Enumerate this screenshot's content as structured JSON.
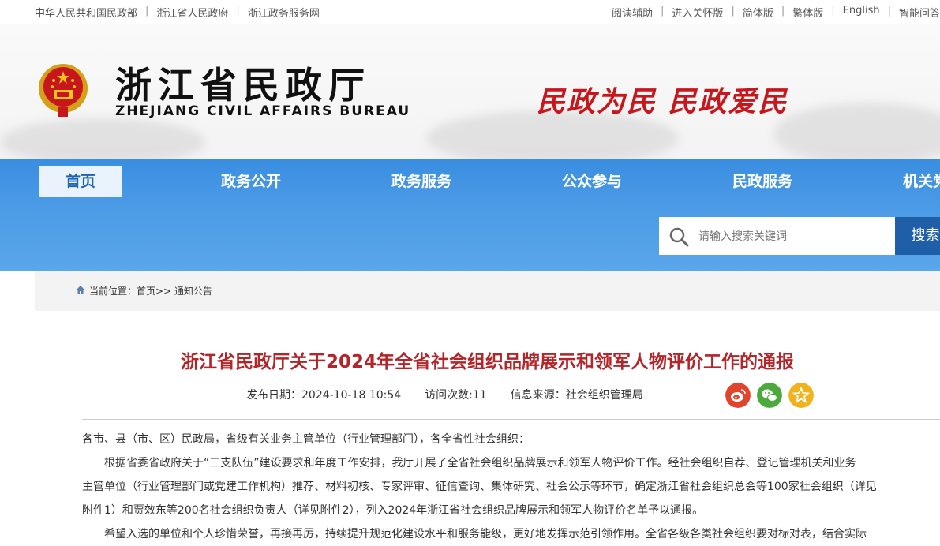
{
  "topbar": {
    "left_links": [
      "中华人民共和国民政部",
      "浙江省人民政府",
      "浙江政务服务网"
    ],
    "right_links": [
      "阅读辅助",
      "进入关怀版",
      "简体版",
      "繁体版",
      "English",
      "智能问答"
    ]
  },
  "header": {
    "title": "浙江省民政厅",
    "subtitle": "ZHEJIANG CIVIL AFFAIRS BUREAU",
    "slogan": "民政为民  民政爱民"
  },
  "nav": {
    "items": [
      "首页",
      "政务公开",
      "政务服务",
      "公众参与",
      "民政服务",
      "机关党建"
    ],
    "active_index": 0
  },
  "search": {
    "placeholder": "请输入搜索关键词",
    "button_label": "搜索"
  },
  "breadcrumb": {
    "text": "当前位置：首页>> 通知公告"
  },
  "article": {
    "title": "浙江省民政厅关于2024年全省社会组织品牌展示和领军人物评价工作的通报",
    "publish_date": "发布日期：2024-10-18 10:54",
    "visits": "访问次数:11",
    "source": "信息来源：社会组织管理局",
    "paragraphs": [
      "各市、县（市、区）民政局，省级有关业务主管单位（行业管理部门），各全省性社会组织：",
      "根据省委省政府关于“三支队伍”建设要求和年度工作安排，我厅开展了全省社会组织品牌展示和领军人物评价工作。经社会组织自荐、登记管理机关和业务",
      "主管单位（行业管理部门或党建工作机构）推荐、材料初核、专家评审、征信查询、集体研究、社会公示等环节，确定浙江省社会组织总会等100家社会组织（详见",
      "附件1）和贾效东等200名社会组织负责人（详见附件2），列入2024年浙江省社会组织品牌展示和领军人物评价名单予以通报。",
      "希望入选的单位和个人珍惜荣誉，再接再厉，持续提升规范化建设水平和服务能级，更好地发挥示范引领作用。全省各级各类社会组织要对标对表，结合实际"
    ]
  },
  "colors": {
    "nav_blue": "#3a8ee0",
    "title_red": "#b2262a",
    "slogan_red": "#c8161d",
    "search_button": "#1f5fa8"
  },
  "share_icons": [
    "weibo-icon",
    "wechat-icon",
    "favorite-icon"
  ]
}
